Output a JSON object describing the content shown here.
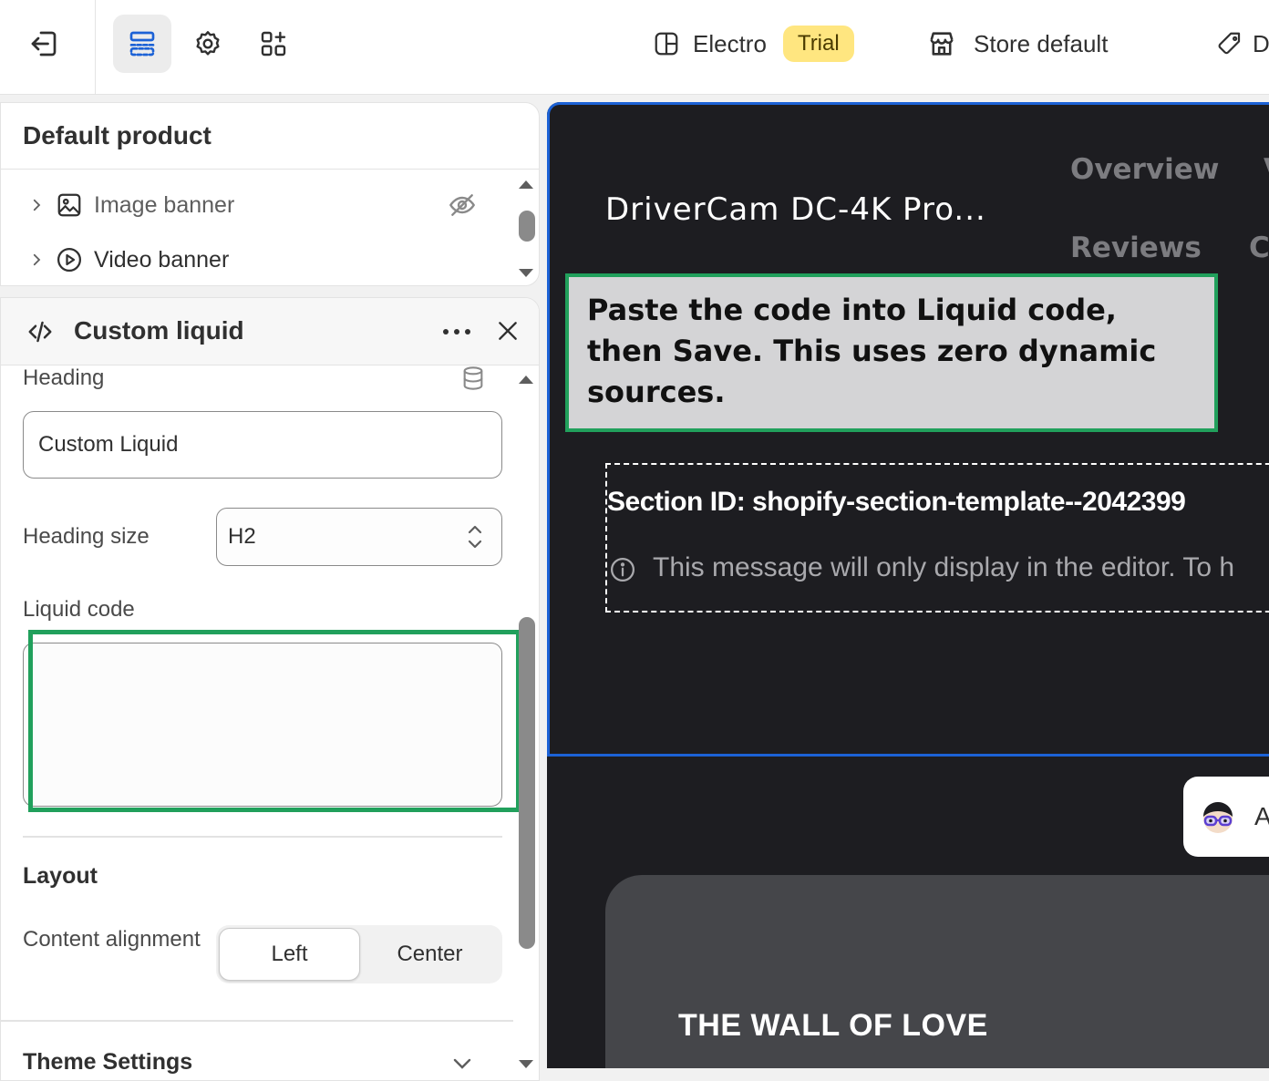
{
  "topbar": {
    "theme_name": "Electro",
    "theme_badge": "Trial",
    "store_name": "Store default",
    "tag_partial": "D"
  },
  "sidebar": {
    "template_title": "Default product",
    "tree": [
      {
        "label": "Image banner",
        "hidden": true
      },
      {
        "label": "Video banner",
        "hidden": false
      }
    ],
    "section": {
      "title": "Custom liquid",
      "heading_label": "Heading",
      "heading_value": "Custom Liquid",
      "heading_size_label": "Heading size",
      "heading_size_value": "H2",
      "liquid_code_label": "Liquid code",
      "liquid_code_value": "",
      "layout_title": "Layout",
      "content_alignment_label": "Content alignment",
      "alignment_options": [
        "Left",
        "Center"
      ],
      "alignment_selected": "Left",
      "theme_settings_title": "Theme Settings"
    }
  },
  "preview": {
    "product_title": "DriverCam DC-4K Pro...",
    "nav": [
      "Overview",
      "V",
      "Reviews",
      "C"
    ],
    "tooltip": "Paste the code into Liquid code, then Save. This uses zero dynamic sources.",
    "section_id": "Section ID: shopify-section-template--2042399",
    "editor_note": "This message will only display in the editor. To h",
    "assistant_letter": "A",
    "wall_title": "THE WALL OF LOVE"
  },
  "colors": {
    "accent_blue": "#1c62d6",
    "highlight_green": "#21a05c",
    "badge_yellow": "#ffe680",
    "preview_bg": "#1d1d21"
  },
  "icons": [
    "exit-icon",
    "sections-icon",
    "gear-icon",
    "apps-icon",
    "theme-icon",
    "store-icon",
    "tag-icon",
    "chevron-right-icon",
    "image-icon",
    "play-icon",
    "eye-off-icon",
    "code-icon",
    "more-icon",
    "close-icon",
    "database-icon",
    "select-arrows-icon",
    "chevron-down-icon",
    "info-icon",
    "assistant-avatar-icon"
  ]
}
